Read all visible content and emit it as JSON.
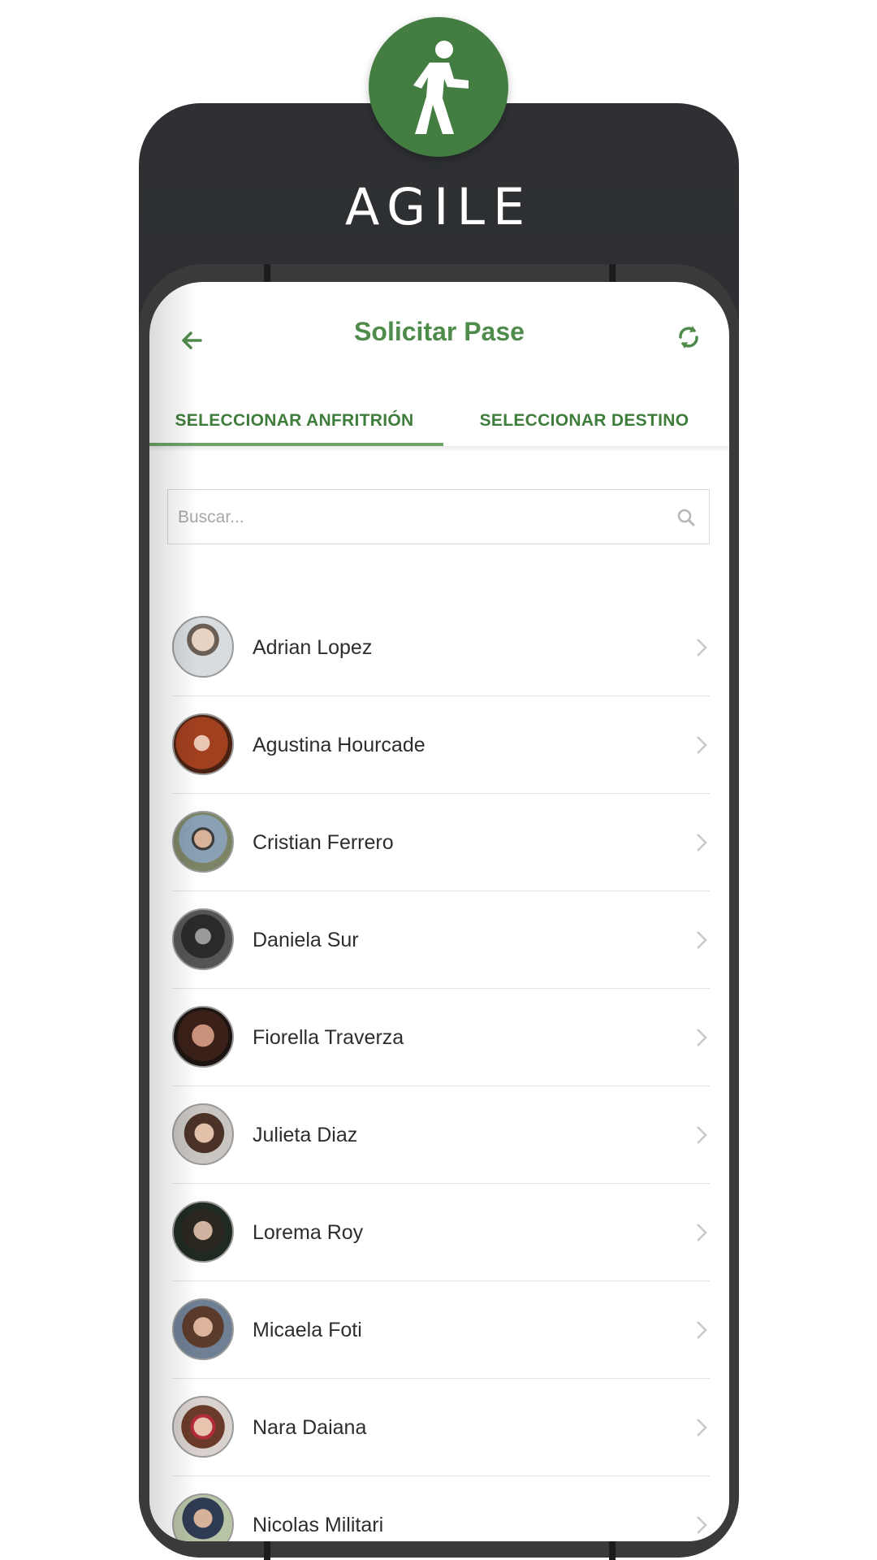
{
  "brand": {
    "name": "AGILE",
    "logo_icon": "walking-person-icon",
    "logo_color": "#447d42"
  },
  "screen": {
    "title": "Solicitar Pase",
    "back_icon": "arrow-left-icon",
    "refresh_icon": "refresh-icon",
    "accent_color": "#4f8c4c"
  },
  "tabs": [
    {
      "label": "SELECCIONAR ANFRITRIÓN",
      "active": true
    },
    {
      "label": "SELECCIONAR DESTINO",
      "active": false
    }
  ],
  "search": {
    "placeholder": "Buscar...",
    "value": "",
    "icon": "search-icon"
  },
  "hosts": [
    {
      "name": "Adrian Lopez",
      "avatar": "photo"
    },
    {
      "name": "Agustina Hourcade",
      "avatar": "photo"
    },
    {
      "name": "Cristian Ferrero",
      "avatar": "photo"
    },
    {
      "name": "Daniela Sur",
      "avatar": "photo"
    },
    {
      "name": "Fiorella Traverza",
      "avatar": "photo"
    },
    {
      "name": "Julieta Diaz",
      "avatar": "photo"
    },
    {
      "name": "Lorema Roy",
      "avatar": "photo"
    },
    {
      "name": "Micaela Foti",
      "avatar": "photo"
    },
    {
      "name": "Nara Daiana",
      "avatar": "photo"
    },
    {
      "name": "Nicolas Militari",
      "avatar": "photo"
    }
  ]
}
